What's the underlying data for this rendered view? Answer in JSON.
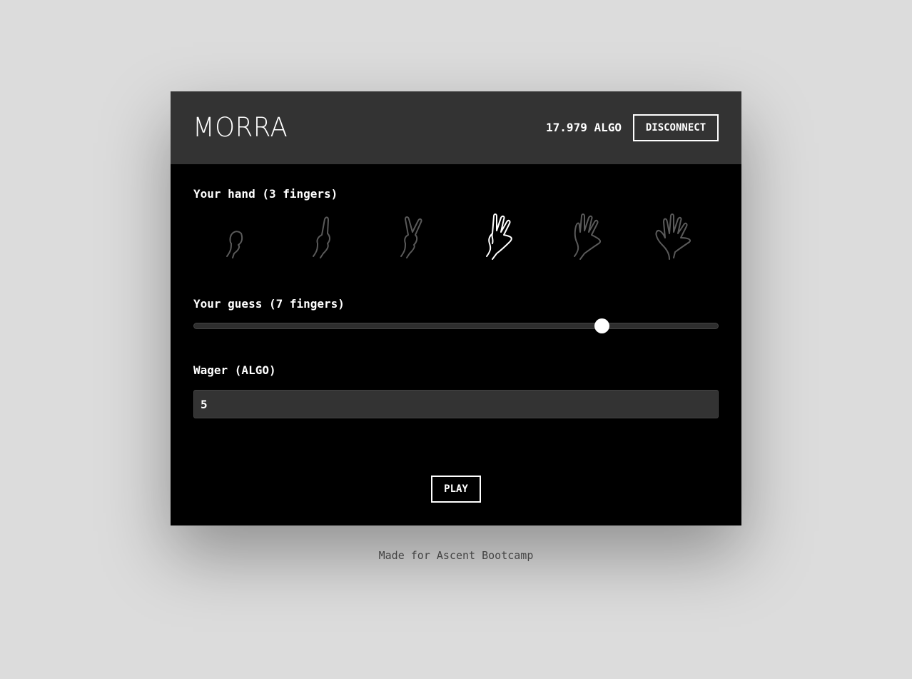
{
  "app": {
    "title": "MORRA",
    "balance": "17.979 ALGO",
    "disconnect_label": "DISCONNECT"
  },
  "hand": {
    "label": "Your hand (3 fingers)",
    "selected_fingers": 3,
    "options": [
      {
        "fingers": 0,
        "icon": "fist-icon"
      },
      {
        "fingers": 1,
        "icon": "one-finger-hand-icon"
      },
      {
        "fingers": 2,
        "icon": "two-fingers-hand-icon"
      },
      {
        "fingers": 3,
        "icon": "three-fingers-hand-icon"
      },
      {
        "fingers": 4,
        "icon": "four-fingers-hand-icon"
      },
      {
        "fingers": 5,
        "icon": "open-hand-icon"
      }
    ]
  },
  "guess": {
    "label": "Your guess (7 fingers)",
    "value": 7,
    "min": 0,
    "max": 9
  },
  "wager": {
    "label": "Wager (ALGO)",
    "value": "5"
  },
  "play_label": "PLAY",
  "footer": "Made for Ascent Bootcamp",
  "colors": {
    "background": "#dcdcdc",
    "card": "#000000",
    "header": "#333333",
    "selected_icon": "#ffffff",
    "unselected_icon": "#5a5a5a"
  }
}
